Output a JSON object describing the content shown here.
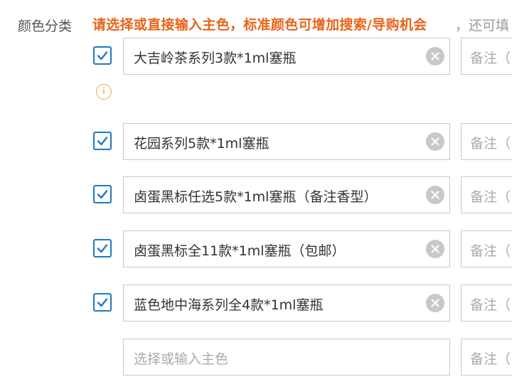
{
  "field": {
    "label": "颜色分类"
  },
  "hint": {
    "emphasis": "请选择或直接输入主色，标准颜色可增加搜索/导购机会",
    "rest": "，还可填"
  },
  "info_icon": {
    "glyph": "i",
    "name": "info-icon"
  },
  "colors": {
    "checkbox_color": "#1e78cc",
    "hint_color": "#e8641b",
    "info_color": "#f0a945"
  },
  "rows": [
    {
      "checked": true,
      "value": "大吉岭茶系列3款*1ml塞瓶",
      "note_placeholder": "备注（"
    },
    {
      "checked": true,
      "value": "花园系列5款*1ml塞瓶",
      "note_placeholder": "备注（"
    },
    {
      "checked": true,
      "value": "卤蛋黑标任选5款*1ml塞瓶（备注香型）",
      "note_placeholder": "备注（"
    },
    {
      "checked": true,
      "value": "卤蛋黑标全11款*1ml塞瓶（包邮）",
      "note_placeholder": "备注（"
    },
    {
      "checked": true,
      "value": "蓝色地中海系列全4款*1ml塞瓶",
      "note_placeholder": "备注（"
    }
  ],
  "new_row": {
    "placeholder": "选择或输入主色",
    "note_placeholder": "备注（"
  }
}
